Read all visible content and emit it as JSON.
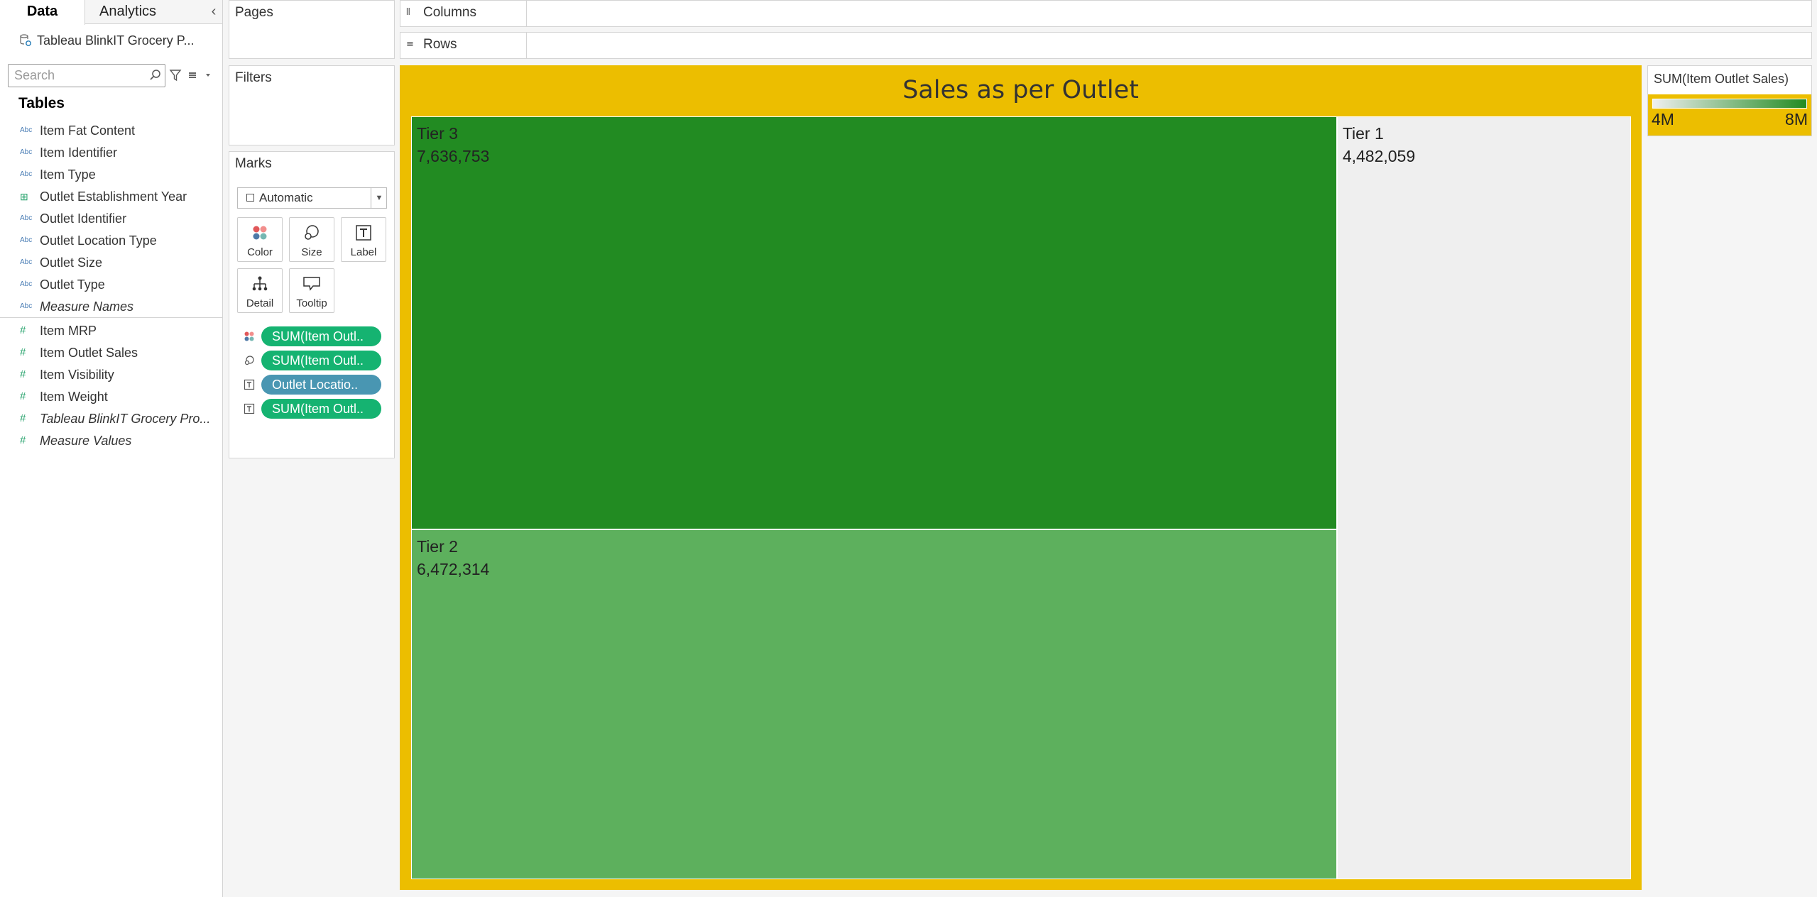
{
  "data_pane": {
    "tabs": [
      {
        "label": "Data"
      },
      {
        "label": "Analytics"
      }
    ],
    "collapse_glyph": "‹",
    "datasource": "Tableau BlinkIT Grocery P...",
    "search_placeholder": "Search",
    "tables_heading": "Tables",
    "fields": [
      {
        "label": "Item Fat Content",
        "type": "Abc"
      },
      {
        "label": "Item Identifier",
        "type": "Abc"
      },
      {
        "label": "Item Type",
        "type": "Abc"
      },
      {
        "label": "Outlet Establishment Year",
        "type": "date"
      },
      {
        "label": "Outlet Identifier",
        "type": "Abc"
      },
      {
        "label": "Outlet Location Type",
        "type": "Abc"
      },
      {
        "label": "Outlet Size",
        "type": "Abc"
      },
      {
        "label": "Outlet Type",
        "type": "Abc"
      },
      {
        "label": "Measure Names",
        "type": "Abc"
      },
      {
        "label": "Item MRP",
        "type": "#"
      },
      {
        "label": "Item Outlet Sales",
        "type": "#"
      },
      {
        "label": "Item Visibility",
        "type": "#"
      },
      {
        "label": "Item Weight",
        "type": "#"
      },
      {
        "label": "Tableau BlinkIT Grocery Pro...",
        "type": "#"
      },
      {
        "label": "Measure Values",
        "type": "#"
      }
    ]
  },
  "pages": {
    "title": "Pages"
  },
  "filters": {
    "title": "Filters"
  },
  "marks": {
    "title": "Marks",
    "mark_type": "Automatic",
    "buttons": [
      "Color",
      "Size",
      "Label",
      "Detail",
      "Tooltip"
    ],
    "pills": [
      {
        "icon": "color-icon",
        "label": "SUM(Item Outl..",
        "color": "#15b371"
      },
      {
        "icon": "size-icon",
        "label": "SUM(Item Outl..",
        "color": "#15b371"
      },
      {
        "icon": "label-icon",
        "label": "Outlet Locatio..",
        "color": "#4996b2"
      },
      {
        "icon": "label-icon",
        "label": "SUM(Item Outl..",
        "color": "#15b371"
      }
    ]
  },
  "shelves": {
    "columns": "Columns",
    "rows": "Rows"
  },
  "viz": {
    "title": "Sales as per Outlet",
    "background": "#ecbe00"
  },
  "chart_data": {
    "type": "treemap",
    "title": "Sales as per Outlet",
    "measure": "SUM(Item Outlet Sales)",
    "dimension": "Outlet Location Type",
    "items": [
      {
        "label": "Tier 3",
        "value": 7636753,
        "display": "7,636,753",
        "color": "#228b22"
      },
      {
        "label": "Tier 2",
        "value": 6472314,
        "display": "6,472,314",
        "color": "#5db05d"
      },
      {
        "label": "Tier 1",
        "value": 4482059,
        "display": "4,482,059",
        "color": "#efefef"
      }
    ]
  },
  "legend": {
    "title": "SUM(Item Outlet Sales)",
    "min_label": "4M",
    "max_label": "8M",
    "color_low": "#efefef",
    "color_high": "#228b22"
  }
}
